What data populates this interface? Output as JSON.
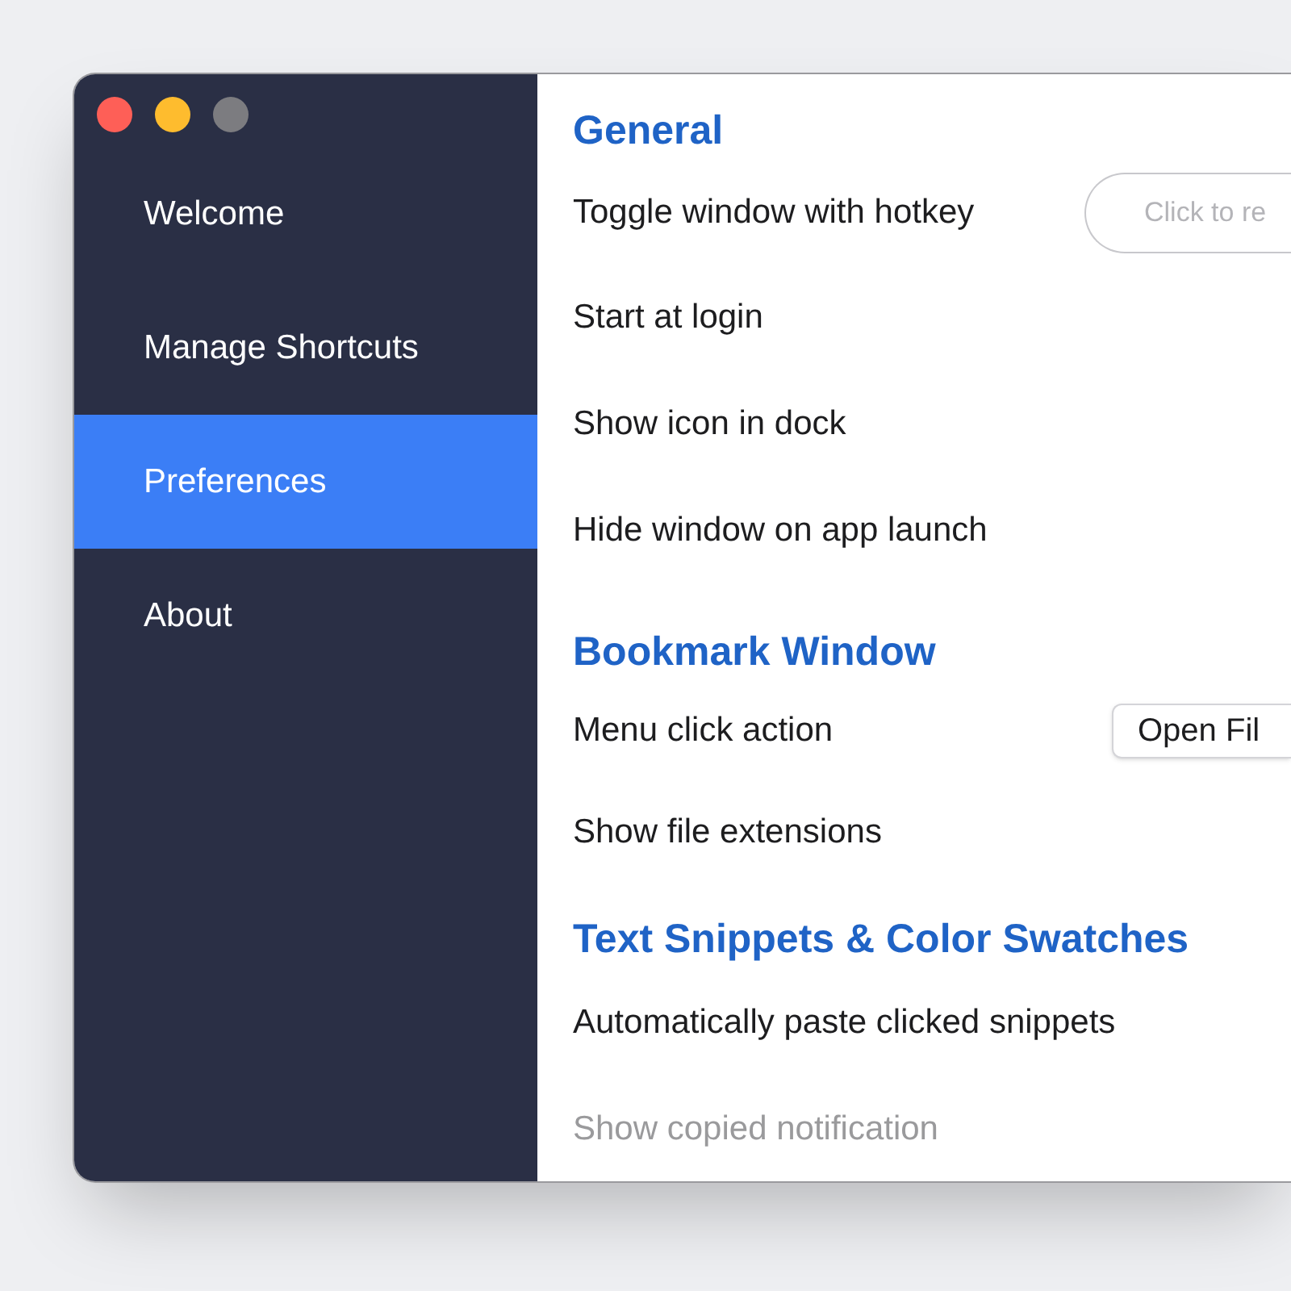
{
  "sidebar": {
    "items": [
      {
        "label": "Welcome",
        "selected": false
      },
      {
        "label": "Manage Shortcuts",
        "selected": false
      },
      {
        "label": "Preferences",
        "selected": true
      },
      {
        "label": "About",
        "selected": false
      }
    ]
  },
  "sections": [
    {
      "title": "General",
      "rows": [
        {
          "kind": "hotkey",
          "label": "Toggle window with hotkey",
          "disabled": false,
          "placeholder": "Click to re"
        },
        {
          "kind": "plain",
          "label": "Start at login",
          "disabled": false
        },
        {
          "kind": "plain",
          "label": "Show icon in dock",
          "disabled": false
        },
        {
          "kind": "plain",
          "label": "Hide window on app launch",
          "disabled": false
        }
      ]
    },
    {
      "title": "Bookmark Window",
      "rows": [
        {
          "kind": "select",
          "label": "Menu click action",
          "disabled": false,
          "value": "Open Fil"
        },
        {
          "kind": "plain",
          "label": "Show file extensions",
          "disabled": false
        }
      ]
    },
    {
      "title": "Text Snippets & Color Swatches",
      "rows": [
        {
          "kind": "plain",
          "label": "Automatically paste clicked snippets",
          "disabled": false
        },
        {
          "kind": "plain",
          "label": "Show copied notification",
          "disabled": true
        }
      ]
    }
  ]
}
